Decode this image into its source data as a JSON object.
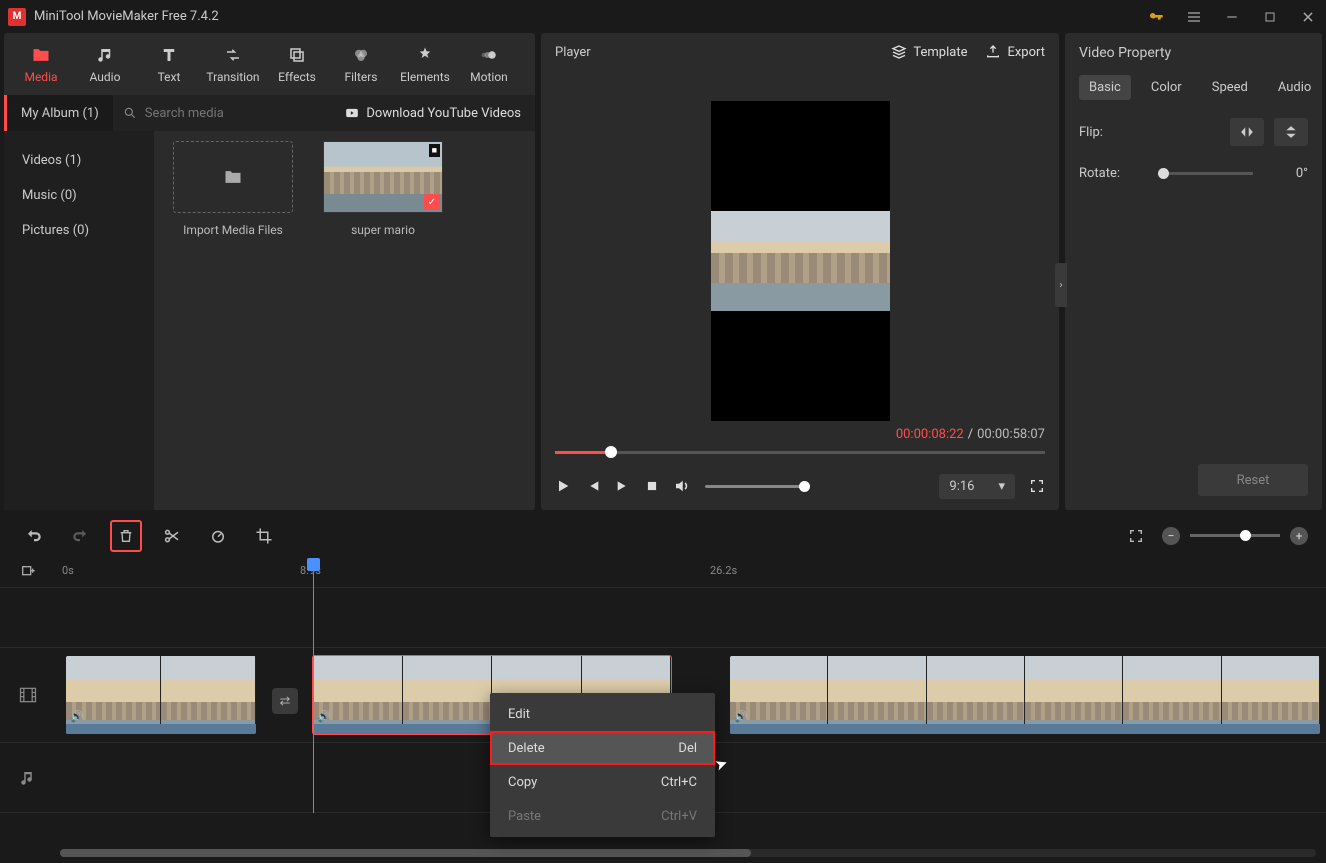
{
  "title": "MiniTool MovieMaker Free 7.4.2",
  "toolbar": [
    {
      "label": "Media",
      "active": true
    },
    {
      "label": "Audio"
    },
    {
      "label": "Text"
    },
    {
      "label": "Transition"
    },
    {
      "label": "Effects"
    },
    {
      "label": "Filters"
    },
    {
      "label": "Elements"
    },
    {
      "label": "Motion"
    }
  ],
  "album_tab": "My Album (1)",
  "search_placeholder": "Search media",
  "download_yt": "Download YouTube Videos",
  "sidebar": [
    {
      "label": "Videos (1)"
    },
    {
      "label": "Music (0)"
    },
    {
      "label": "Pictures (0)"
    }
  ],
  "media": {
    "import_label": "Import Media Files",
    "clip_label": "super mario"
  },
  "player": {
    "title": "Player",
    "template": "Template",
    "export": "Export",
    "cur": "00:00:08:22",
    "sep": " / ",
    "tot": "00:00:58:07",
    "ratio": "9:16"
  },
  "props": {
    "title": "Video Property",
    "tabs": [
      "Basic",
      "Color",
      "Speed",
      "Audio"
    ],
    "flip": "Flip:",
    "rotate": "Rotate:",
    "rotate_val": "0°",
    "reset": "Reset"
  },
  "ruler": {
    "t0": "0s",
    "t1": "8.9s",
    "t2": "26.2s"
  },
  "ctx": [
    {
      "label": "Edit",
      "sc": ""
    },
    {
      "label": "Delete",
      "sc": "Del",
      "hl": true
    },
    {
      "label": "Copy",
      "sc": "Ctrl+C"
    },
    {
      "label": "Paste",
      "sc": "Ctrl+V",
      "dis": true
    }
  ]
}
